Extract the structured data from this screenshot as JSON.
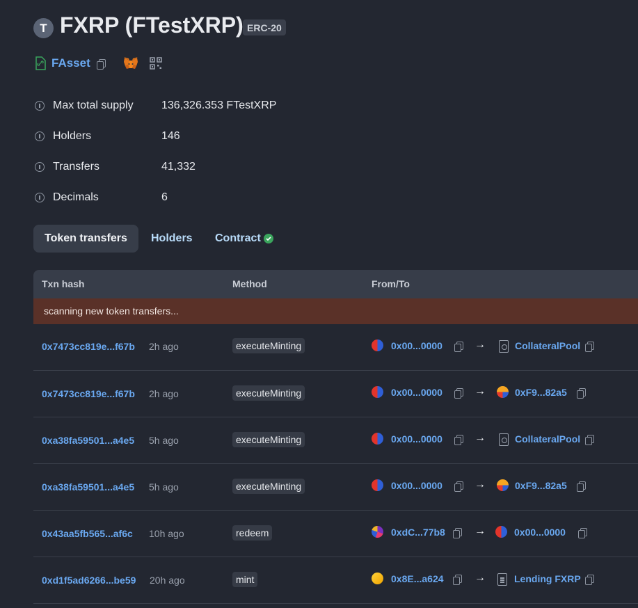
{
  "token": {
    "avatar_letter": "T",
    "title": "FXRP (FTestXRP)",
    "standard": "ERC-20",
    "name_link": "FAsset"
  },
  "details": [
    {
      "label": "Max total supply",
      "value": "136,326.353 FTestXRP",
      "is_link": false
    },
    {
      "label": "Holders",
      "value": "146",
      "is_link": true
    },
    {
      "label": "Transfers",
      "value": "41,332",
      "is_link": true
    },
    {
      "label": "Decimals",
      "value": "6",
      "is_link": false
    }
  ],
  "tabs": [
    "Token transfers",
    "Holders",
    "Contract"
  ],
  "table": {
    "headers": [
      "Txn hash",
      "Method",
      "From/To"
    ],
    "scanning_text": "scanning new token transfers...",
    "rows": [
      {
        "hash": "0x7473cc819e...f67b",
        "age": "2h ago",
        "method": "executeMinting",
        "from": "0x00...0000",
        "to": "CollateralPool"
      },
      {
        "hash": "0x7473cc819e...f67b",
        "age": "2h ago",
        "method": "executeMinting",
        "from": "0x00...0000",
        "to": "0xF9...82a5"
      },
      {
        "hash": "0xa38fa59501...a4e5",
        "age": "5h ago",
        "method": "executeMinting",
        "from": "0x00...0000",
        "to": "CollateralPool"
      },
      {
        "hash": "0xa38fa59501...a4e5",
        "age": "5h ago",
        "method": "executeMinting",
        "from": "0x00...0000",
        "to": "0xF9...82a5"
      },
      {
        "hash": "0x43aa5fb565...af6c",
        "age": "10h ago",
        "method": "redeem",
        "from": "0xdC...77b8",
        "to": "0x00...0000"
      },
      {
        "hash": "0xd1f5ad6266...be59",
        "age": "20h ago",
        "method": "mint",
        "from": "0x8E...a624",
        "to": "Lending FXRP"
      }
    ]
  },
  "colors": {
    "background": "#232731",
    "link": "#6aa8f0",
    "scan_banner": "#5a3128",
    "verified": "#3ba55d"
  }
}
